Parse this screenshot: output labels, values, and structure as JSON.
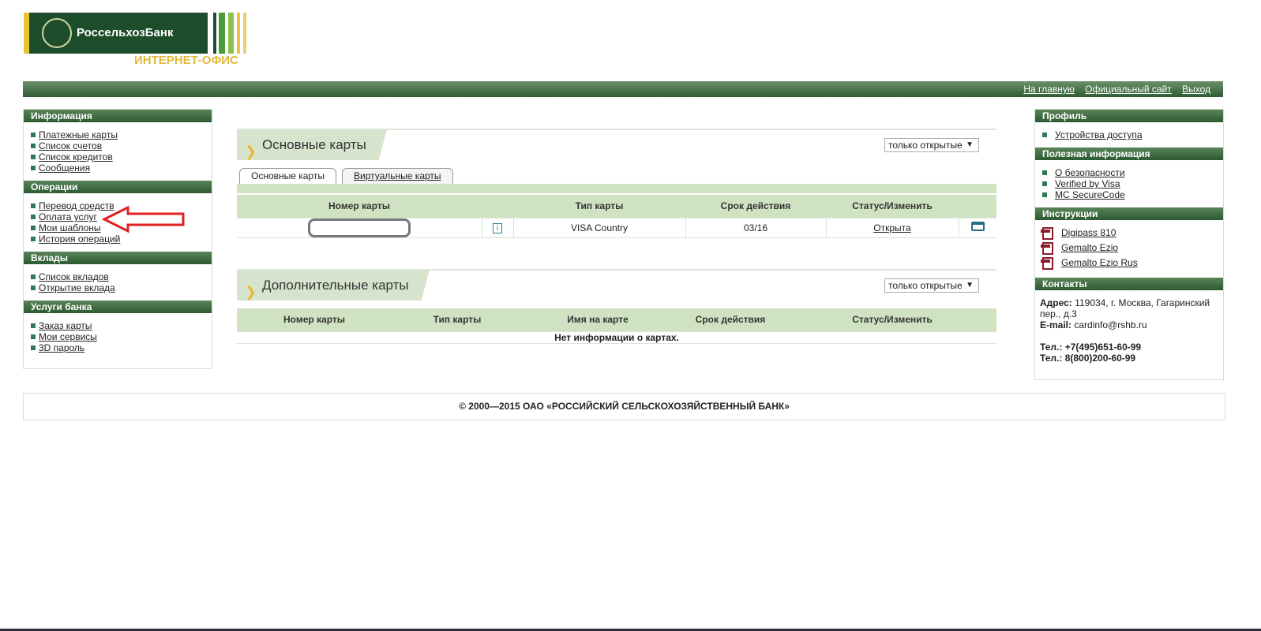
{
  "logo": {
    "bank_name": "РоссельхозБанк",
    "subtitle": "ИНТЕРНЕТ-ОФИС",
    "emblem": "РСХБ"
  },
  "topnav": {
    "home": "На главную",
    "official": "Официальный сайт",
    "logout": "Выход"
  },
  "left": {
    "info": {
      "title": "Информация",
      "items": [
        "Платежные карты",
        "Список счетов",
        "Список кредитов",
        "Сообщения"
      ]
    },
    "ops": {
      "title": "Операции",
      "items": [
        "Перевод средств",
        "Оплата услуг",
        "Мои шаблоны",
        "История операций"
      ]
    },
    "deposits": {
      "title": "Вклады",
      "items": [
        "Список вкладов",
        "Открытие вклада"
      ]
    },
    "services": {
      "title": "Услуги банка",
      "items": [
        "Заказ карты",
        "Мои сервисы",
        "3D пароль"
      ]
    }
  },
  "main": {
    "section1": {
      "title": "Основные карты",
      "filter": "только открытые",
      "tabs": [
        "Основные карты",
        "Виртуальные карты"
      ],
      "columns": [
        "Номер карты",
        "Тип карты",
        "Срок действия",
        "Статус/Изменить"
      ],
      "rows": [
        {
          "card_number": "",
          "type": "VISA Country",
          "expiry": "03/16",
          "status": "Открыта"
        }
      ]
    },
    "section2": {
      "title": "Дополнительные карты",
      "filter": "только открытые",
      "columns": [
        "Номер карты",
        "Тип карты",
        "Имя на карте",
        "Срок действия",
        "Статус/Изменить"
      ],
      "empty": "Нет информации о картах."
    }
  },
  "right": {
    "profile": {
      "title": "Профиль",
      "items": [
        "Устройства доступа"
      ]
    },
    "useful": {
      "title": "Полезная информация",
      "items": [
        "О безопасности",
        "Verified by Visa",
        "MC SecureCode"
      ]
    },
    "instructions": {
      "title": "Инструкции",
      "items": [
        "Digipass 810",
        "Gemalto Ezio",
        "Gemalto Ezio Rus"
      ]
    },
    "contacts": {
      "title": "Контакты",
      "address_label": "Адрес:",
      "address": "119034, г. Москва, Гагаринский пер., д.3",
      "email_label": "E-mail:",
      "email": "cardinfo@rshb.ru",
      "phone1": "Тел.: +7(495)651-60-99",
      "phone2": "Тел.:  8(800)200-60-99"
    }
  },
  "footer": "© 2000—2015 ОАО «РОССИЙСКИЙ СЕЛЬСКОХОЗЯЙСТВЕННЫЙ БАНК»",
  "colors": {
    "brand_green": "#1e4d2b",
    "accent_yellow": "#e8c530",
    "header_green": "#cfe3c3",
    "annotation_red": "#e02020"
  }
}
